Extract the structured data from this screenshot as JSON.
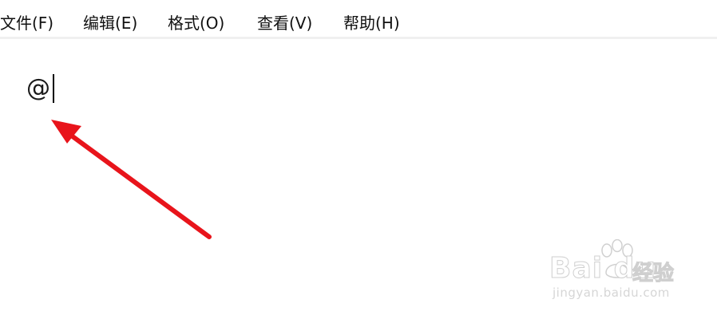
{
  "menubar": {
    "items": [
      {
        "label": "文件(F)"
      },
      {
        "label": "编辑(E)"
      },
      {
        "label": "格式(O)"
      },
      {
        "label": "查看(V)"
      },
      {
        "label": "帮助(H)"
      }
    ]
  },
  "editor": {
    "content": "@"
  },
  "annotation": {
    "arrow_color": "#e8141b"
  },
  "watermark": {
    "brand": "Bai du",
    "product": "经验",
    "url": "jingyan.baidu.com"
  },
  "colors": {
    "background": "#ffffff",
    "menubar_border": "#f0f0f0",
    "text": "#111111",
    "watermark": "#cfcfcf"
  }
}
